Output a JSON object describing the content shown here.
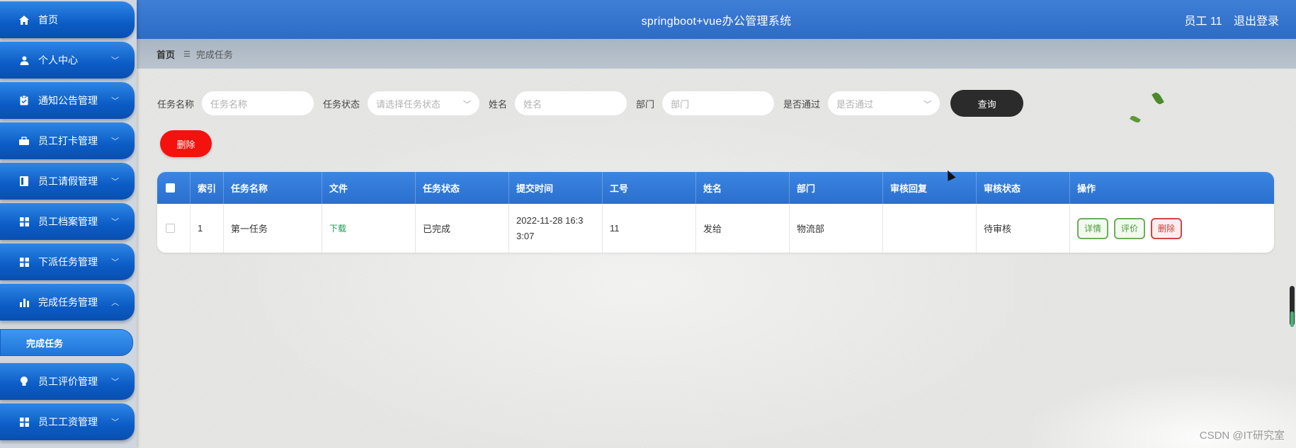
{
  "app": {
    "title": "springboot+vue办公管理系统",
    "user_label": "员工 11",
    "logout_label": "退出登录"
  },
  "sidebar": {
    "items": [
      {
        "label": "首页",
        "icon": "home-icon"
      },
      {
        "label": "个人中心",
        "icon": "user-icon"
      },
      {
        "label": "通知公告管理",
        "icon": "clipboard-icon"
      },
      {
        "label": "员工打卡管理",
        "icon": "briefcase-icon"
      },
      {
        "label": "员工请假管理",
        "icon": "book-icon"
      },
      {
        "label": "员工档案管理",
        "icon": "grid-icon"
      },
      {
        "label": "下派任务管理",
        "icon": "grid-icon"
      },
      {
        "label": "完成任务管理",
        "icon": "bar-chart-icon"
      },
      {
        "label": "员工评价管理",
        "icon": "bulb-icon"
      },
      {
        "label": "员工工资管理",
        "icon": "grid-icon"
      }
    ],
    "active_sub": "完成任务"
  },
  "breadcrumb": {
    "home": "首页",
    "current": "完成任务"
  },
  "search": {
    "task_name_label": "任务名称",
    "task_name_placeholder": "任务名称",
    "task_status_label": "任务状态",
    "task_status_placeholder": "请选择任务状态",
    "name_label": "姓名",
    "name_placeholder": "姓名",
    "dept_label": "部门",
    "dept_placeholder": "部门",
    "passed_label": "是否通过",
    "passed_placeholder": "是否通过",
    "query_label": "查询"
  },
  "actions": {
    "delete_label": "删除"
  },
  "table": {
    "headers": [
      "索引",
      "任务名称",
      "文件",
      "任务状态",
      "提交时间",
      "工号",
      "姓名",
      "部门",
      "审核回复",
      "审核状态",
      "操作"
    ],
    "rows": [
      {
        "index": "1",
        "task_name": "第一任务",
        "file": "下载",
        "status": "已完成",
        "submit_time_line1": "2022-11-28 16:3",
        "submit_time_line2": "3:07",
        "emp_no": "11",
        "name": "发给",
        "dept": "物流部",
        "review_reply": "",
        "review_status": "待审核",
        "op_detail": "详情",
        "op_rate": "评价",
        "op_delete": "删除"
      }
    ]
  },
  "watermark": "CSDN @IT研究室",
  "colors": {
    "header": "#2d6bc6",
    "sidebar_item": "#0b5cc5",
    "delete": "#f4120e",
    "query": "#2b2b2b",
    "link": "#1a9a55"
  }
}
